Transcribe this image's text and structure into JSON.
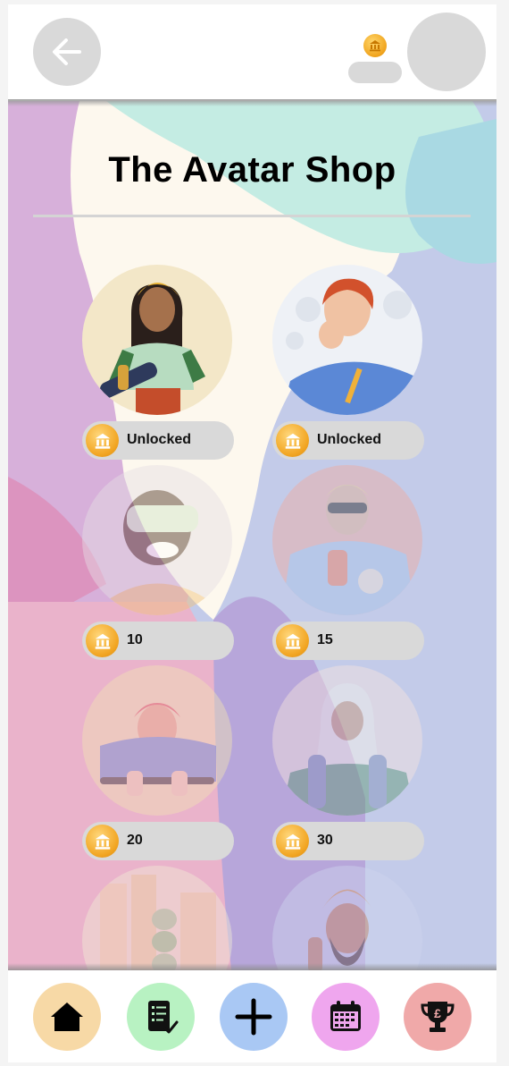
{
  "header": {
    "back_icon": "arrow-left-icon",
    "coin_icon": "bank-coin-icon",
    "profile_icon": "avatar-placeholder"
  },
  "page": {
    "title": "The Avatar Shop"
  },
  "avatars": [
    {
      "name": "skater",
      "price_label": "Unlocked",
      "locked": false
    },
    {
      "name": "thinker",
      "price_label": "Unlocked",
      "locked": false
    },
    {
      "name": "vr-headset",
      "price_label": "10",
      "locked": true
    },
    {
      "name": "sunglasses-drink",
      "price_label": "15",
      "locked": true
    },
    {
      "name": "cyclist",
      "price_label": "20",
      "locked": true
    },
    {
      "name": "hijab-backpack",
      "price_label": "30",
      "locked": true
    },
    {
      "name": "bookworm",
      "price_label": "",
      "locked": true
    },
    {
      "name": "turban-man",
      "price_label": "",
      "locked": true
    }
  ],
  "nav": [
    {
      "name": "home",
      "icon": "home-icon",
      "color": "#f7d9a6"
    },
    {
      "name": "tasks",
      "icon": "checklist-icon",
      "color": "#b8f2c2"
    },
    {
      "name": "add",
      "icon": "plus-icon",
      "color": "#a9c8f4"
    },
    {
      "name": "calendar",
      "icon": "calendar-icon",
      "color": "#efa6ee"
    },
    {
      "name": "rewards",
      "icon": "trophy-pound-icon",
      "color": "#f0a9a9"
    }
  ],
  "colors": {
    "pill": "#d9d9d9",
    "coin": "#f2a624",
    "background": "#c3cbe9"
  }
}
